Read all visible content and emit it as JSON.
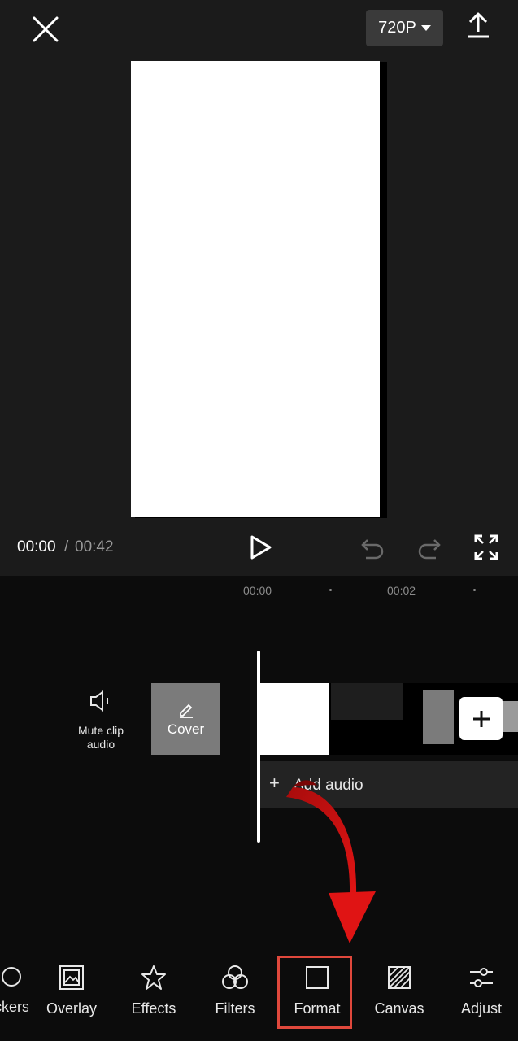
{
  "header": {
    "resolution_label": "720P"
  },
  "player": {
    "current_time": "00:00",
    "separator": "/",
    "total_time": "00:42"
  },
  "timeline": {
    "tick_labels": [
      "00:00",
      "00:02"
    ],
    "mute_label": "Mute clip audio",
    "cover_label": "Cover",
    "add_audio_label": "Add audio",
    "add_audio_plus": "+"
  },
  "toolbar": {
    "items": [
      {
        "label": "Stickers",
        "icon": "sticker-icon"
      },
      {
        "label": "Overlay",
        "icon": "overlay-icon"
      },
      {
        "label": "Effects",
        "icon": "effects-star-icon"
      },
      {
        "label": "Filters",
        "icon": "filters-icon"
      },
      {
        "label": "Format",
        "icon": "format-square-icon"
      },
      {
        "label": "Canvas",
        "icon": "canvas-hatch-icon"
      },
      {
        "label": "Adjust",
        "icon": "adjust-sliders-icon"
      }
    ]
  },
  "colors": {
    "highlight": "#e0483c",
    "arrow": "#c41010"
  }
}
